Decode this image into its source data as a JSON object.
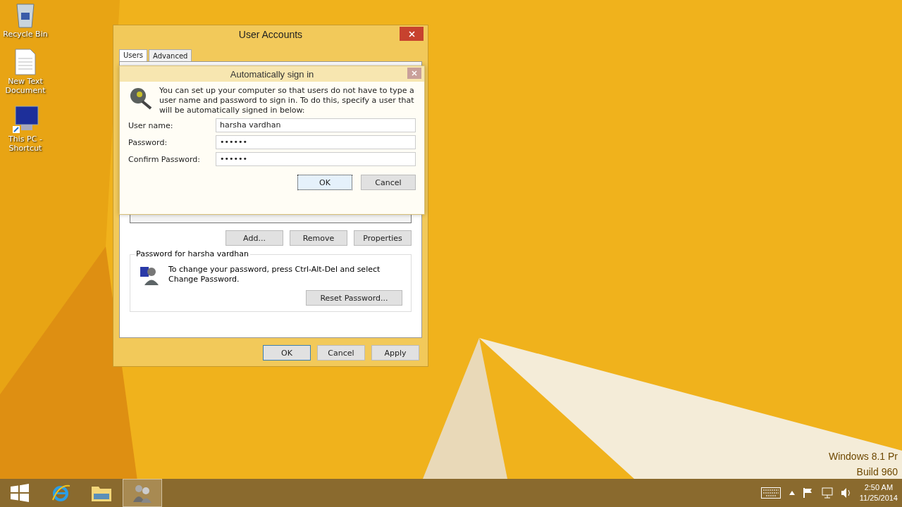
{
  "desktop_icons": [
    {
      "kind": "bin",
      "label": "Recycle Bin"
    },
    {
      "kind": "doc",
      "label": "New Text Document"
    },
    {
      "kind": "pc",
      "label": "This PC - Shortcut"
    }
  ],
  "watermark": [
    "Windows 8.1 Pr",
    "Build 960"
  ],
  "window": {
    "title": "User Accounts",
    "tabs": [
      {
        "label": "Users",
        "selected": true
      },
      {
        "label": "Advanced",
        "selected": false
      }
    ],
    "list_buttons": [
      "Add...",
      "Remove",
      "Properties"
    ],
    "password_group": {
      "title": "Password for harsha vardhan",
      "text": "To change your password, press Ctrl-Alt-Del and select Change Password.",
      "button": "Reset Password..."
    },
    "buttons": [
      "OK",
      "Cancel",
      "Apply"
    ]
  },
  "dialog": {
    "title": "Automatically sign in",
    "text": "You can set up your computer so that users do not have to type a user name and password to sign in. To do this, specify a user that will be automatically signed in below:",
    "fields": [
      {
        "label": "User name:",
        "value": "harsha vardhan"
      },
      {
        "label": "Password:",
        "value": "••••••"
      },
      {
        "label": "Confirm Password:",
        "value": "••••••"
      }
    ],
    "buttons": [
      {
        "label": "OK",
        "focused": true
      },
      {
        "label": "Cancel",
        "focused": false
      }
    ]
  },
  "taskbar": {
    "apps": [
      {
        "kind": "start",
        "selected": false
      },
      {
        "kind": "browser",
        "selected": false
      },
      {
        "kind": "folder",
        "selected": false
      },
      {
        "kind": "users",
        "selected": true
      }
    ],
    "time": "2:50 AM",
    "date": "11/25/2014"
  }
}
